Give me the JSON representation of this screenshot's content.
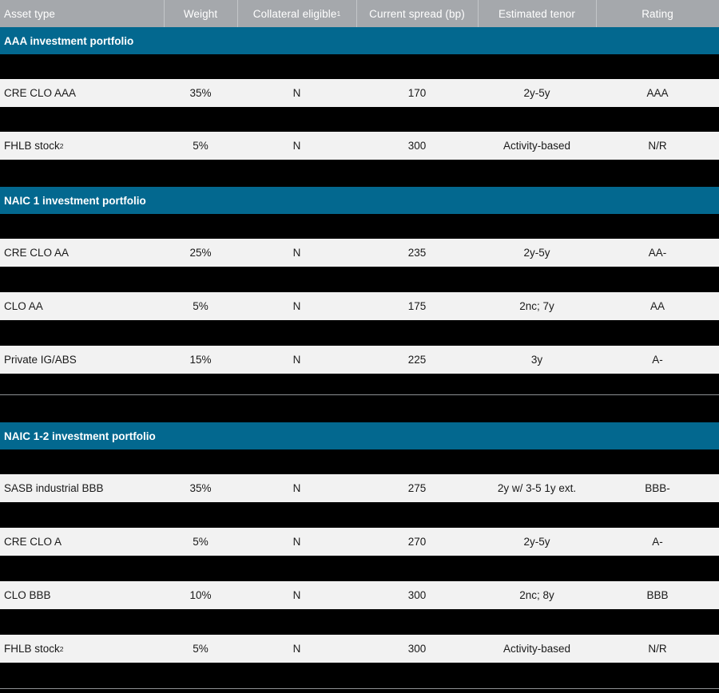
{
  "colors": {
    "header_bg": "#a5a8ac",
    "section_bg": "#03688f",
    "row_bg": "#f2f2f2",
    "page_bg": "#000000",
    "rule": "#8e9093",
    "text": "#1a1a1a",
    "header_text": "#ffffff"
  },
  "table": {
    "columns": [
      {
        "key": "asset_type",
        "label": "Asset type",
        "sup": ""
      },
      {
        "key": "weight",
        "label": "Weight",
        "sup": ""
      },
      {
        "key": "collateral",
        "label": "Collateral eligible",
        "sup": "1"
      },
      {
        "key": "spread",
        "label": "Current spread (bp)",
        "sup": ""
      },
      {
        "key": "tenor",
        "label": "Estimated tenor",
        "sup": ""
      },
      {
        "key": "rating",
        "label": "Rating",
        "sup": ""
      }
    ],
    "sections": [
      {
        "title": "AAA investment portfolio",
        "rows": [
          {
            "asset_type": "CRE CLO AAA",
            "asset_sup": "",
            "weight": "35%",
            "collateral": "N",
            "spread": "170",
            "tenor": "2y-5y",
            "rating": "AAA"
          },
          {
            "asset_type": "FHLB stock",
            "asset_sup": "2",
            "weight": "5%",
            "collateral": "N",
            "spread": "300",
            "tenor": "Activity-based",
            "rating": "N/R"
          }
        ]
      },
      {
        "title": "NAIC 1 investment portfolio",
        "rows": [
          {
            "asset_type": "CRE CLO AA",
            "asset_sup": "",
            "weight": "25%",
            "collateral": "N",
            "spread": "235",
            "tenor": "2y-5y",
            "rating": "AA-"
          },
          {
            "asset_type": "CLO AA",
            "asset_sup": "",
            "weight": "5%",
            "collateral": "N",
            "spread": "175",
            "tenor": "2nc; 7y",
            "rating": "AA"
          },
          {
            "asset_type": "Private IG/ABS",
            "asset_sup": "",
            "weight": "15%",
            "collateral": "N",
            "spread": "225",
            "tenor": "3y",
            "rating": "A-"
          }
        ]
      },
      {
        "title": "NAIC 1-2 investment portfolio",
        "rows": [
          {
            "asset_type": "SASB industrial BBB",
            "asset_sup": "",
            "weight": "35%",
            "collateral": "N",
            "spread": "275",
            "tenor": "2y w/ 3-5 1y ext.",
            "rating": "BBB-"
          },
          {
            "asset_type": "CRE CLO A",
            "asset_sup": "",
            "weight": "5%",
            "collateral": "N",
            "spread": "270",
            "tenor": "2y-5y",
            "rating": "A-"
          },
          {
            "asset_type": "CLO BBB",
            "asset_sup": "",
            "weight": "10%",
            "collateral": "N",
            "spread": "300",
            "tenor": "2nc; 8y",
            "rating": "BBB"
          },
          {
            "asset_type": "FHLB stock",
            "asset_sup": "2",
            "weight": "5%",
            "collateral": "N",
            "spread": "300",
            "tenor": "Activity-based",
            "rating": "N/R"
          }
        ]
      }
    ]
  }
}
